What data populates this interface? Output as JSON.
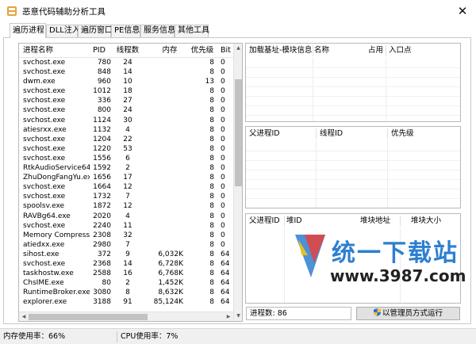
{
  "window": {
    "title": "恶意代码辅助分析工具",
    "close_glyph": "✕"
  },
  "tabs": [
    {
      "label": "遍历进程",
      "active": true
    },
    {
      "label": "DLL注入",
      "active": false
    },
    {
      "label": "遍历窗口",
      "active": false
    },
    {
      "label": "PE信息",
      "active": false
    },
    {
      "label": "服务信息",
      "active": false
    },
    {
      "label": "其他工具",
      "active": false
    }
  ],
  "process_table": {
    "headers": {
      "name": "进程名称",
      "pid": "PID",
      "threads": "线程数",
      "memory": "内存",
      "priority": "优先级",
      "bit": "Bit"
    },
    "rows": [
      [
        "svchost.exe",
        "780",
        "24",
        "",
        "8",
        "0"
      ],
      [
        "svchost.exe",
        "848",
        "14",
        "",
        "8",
        "0"
      ],
      [
        "dwm.exe",
        "960",
        "10",
        "",
        "13",
        "0"
      ],
      [
        "svchost.exe",
        "1012",
        "18",
        "",
        "8",
        "0"
      ],
      [
        "svchost.exe",
        "336",
        "27",
        "",
        "8",
        "0"
      ],
      [
        "svchost.exe",
        "800",
        "24",
        "",
        "8",
        "0"
      ],
      [
        "svchost.exe",
        "1124",
        "30",
        "",
        "8",
        "0"
      ],
      [
        "atiesrxx.exe",
        "1132",
        "4",
        "",
        "8",
        "0"
      ],
      [
        "svchost.exe",
        "1204",
        "22",
        "",
        "8",
        "0"
      ],
      [
        "svchost.exe",
        "1220",
        "53",
        "",
        "8",
        "0"
      ],
      [
        "svchost.exe",
        "1556",
        "6",
        "",
        "8",
        "0"
      ],
      [
        "RtkAudioService64....",
        "1592",
        "2",
        "",
        "8",
        "0"
      ],
      [
        "ZhuDongFangYu.exe",
        "1656",
        "17",
        "",
        "8",
        "0"
      ],
      [
        "svchost.exe",
        "1664",
        "12",
        "",
        "8",
        "0"
      ],
      [
        "svchost.exe",
        "1732",
        "7",
        "",
        "8",
        "0"
      ],
      [
        "spoolsv.exe",
        "1872",
        "12",
        "",
        "8",
        "0"
      ],
      [
        "RAVBg64.exe",
        "2020",
        "4",
        "",
        "8",
        "0"
      ],
      [
        "svchost.exe",
        "2240",
        "11",
        "",
        "8",
        "0"
      ],
      [
        "Memory Compression",
        "2308",
        "32",
        "",
        "8",
        "0"
      ],
      [
        "atiedxx.exe",
        "2980",
        "7",
        "",
        "8",
        "0"
      ],
      [
        "sihost.exe",
        "372",
        "9",
        "6,032K",
        "8",
        "64"
      ],
      [
        "svchost.exe",
        "2368",
        "14",
        "6,728K",
        "8",
        "64"
      ],
      [
        "taskhostw.exe",
        "2588",
        "16",
        "6,768K",
        "8",
        "64"
      ],
      [
        "ChsIME.exe",
        "80",
        "2",
        "1,452K",
        "8",
        "64"
      ],
      [
        "RuntimeBroker.exe",
        "3080",
        "8",
        "8,632K",
        "8",
        "64"
      ],
      [
        "explorer.exe",
        "3188",
        "91",
        "85,124K",
        "8",
        "64"
      ]
    ]
  },
  "module_panel": {
    "headers": [
      "加载基址-模块信息",
      "名称",
      "占用",
      "入口点"
    ]
  },
  "thread_panel": {
    "headers": [
      "父进程ID",
      "线程ID",
      "优先级"
    ]
  },
  "heap_panel": {
    "headers": [
      "父进程ID",
      "堆ID",
      "堆块地址",
      "堆块大小"
    ]
  },
  "process_count": "进程数: 86",
  "admin_button": "以管理员方式运行",
  "statusbar": {
    "memory": "内存使用率：66%",
    "cpu": "CPU使用率：7%"
  },
  "watermark": {
    "text": "统一下载站",
    "url": "www.3987.com"
  },
  "colors": {
    "accent": "#2d7fd1",
    "shield_blue": "#2a6fd6",
    "shield_yellow": "#f2c230"
  }
}
